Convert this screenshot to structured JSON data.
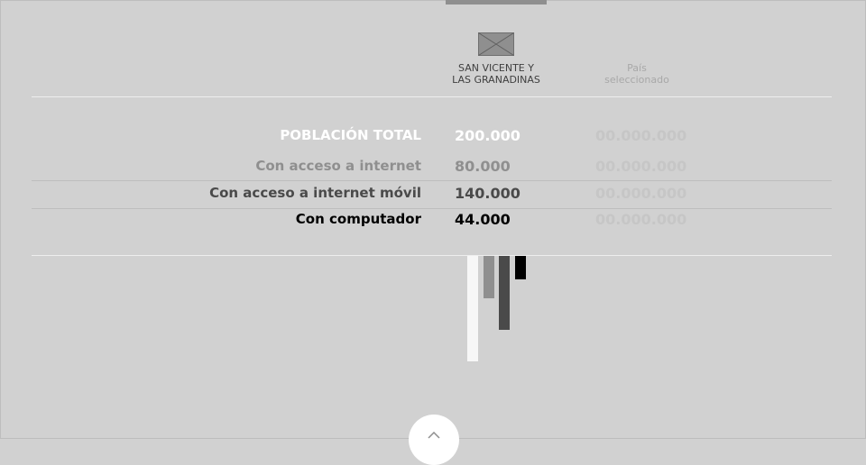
{
  "header": {
    "country_name_line1": "SAN VICENTE Y",
    "country_name_line2": "LAS GRANADINAS",
    "selected_line1": "País",
    "selected_line2": "seleccionado",
    "flag_icon": "image-placeholder-icon"
  },
  "rows": [
    {
      "label": "POBLACIÓN TOTAL",
      "value": "200.000",
      "selected_value": "00.000.000",
      "color": "#ffffff"
    },
    {
      "label": "Con acceso a internet",
      "value": "80.000",
      "selected_value": "00.000.000",
      "color": "#8f8f8f"
    },
    {
      "label": "Con acceso a internet móvil",
      "value": "140.000",
      "selected_value": "00.000.000",
      "color": "#4a4a4a"
    },
    {
      "label": "Con computador",
      "value": "44.000",
      "selected_value": "00.000.000",
      "color": "#000000"
    }
  ],
  "chart_data": {
    "type": "bar",
    "categories": [
      "POBLACIÓN TOTAL",
      "Con acceso a internet",
      "Con acceso a internet móvil",
      "Con computador"
    ],
    "values": [
      200000,
      80000,
      140000,
      44000
    ],
    "colors": [
      "#f7f7f7",
      "#8f8f8f",
      "#4a4a4a",
      "#000000"
    ]
  },
  "scroll_up_icon": "chevron-up-icon"
}
